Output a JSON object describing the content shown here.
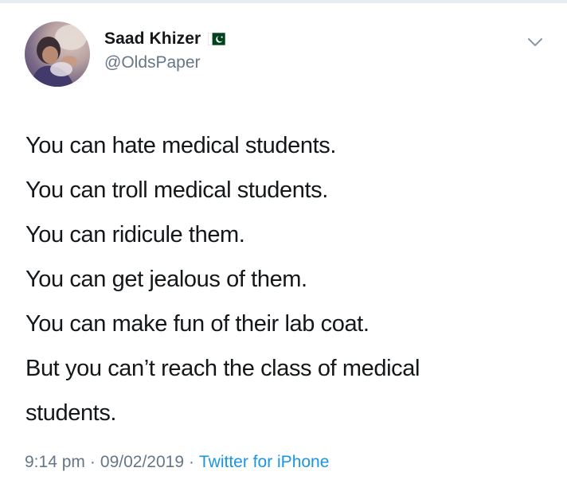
{
  "tweet": {
    "author": {
      "display_name": "Saad Khizer",
      "handle": "@OldsPaper",
      "flag_icon": "pakistan-flag-icon",
      "avatar_icon": "profile-photo"
    },
    "menu_icon": "chevron-down-icon",
    "text_lines": [
      "You can hate medical students.",
      "You can troll medical students.",
      "You can ridicule them.",
      "You can get jealous of them.",
      "You can make fun of their lab coat.",
      "But you can’t reach the class of medical",
      "students."
    ],
    "meta": {
      "time": "9:14 pm",
      "date": "09/02/2019",
      "separator": "·",
      "source": "Twitter for iPhone"
    },
    "colors": {
      "text": "#14171a",
      "secondary": "#657786",
      "link": "#1b95e0",
      "flag_green": "#01411c"
    }
  }
}
